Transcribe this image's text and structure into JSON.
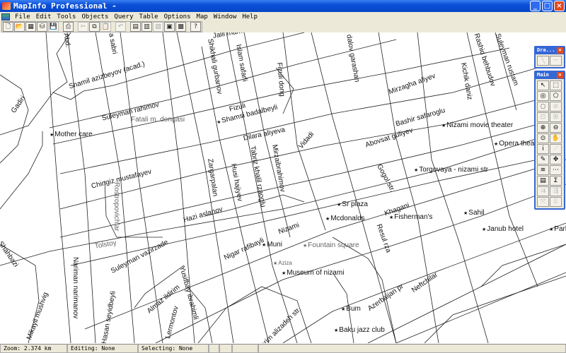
{
  "window": {
    "title": "MapInfo Professional -",
    "minimize": "_",
    "maximize": "□",
    "close": "×"
  },
  "menu": [
    "File",
    "Edit",
    "Tools",
    "Objects",
    "Query",
    "Table",
    "Options",
    "Map",
    "Window",
    "Help"
  ],
  "toolbar": {
    "new": "🗋",
    "open": "📂",
    "open_workspace": "▦",
    "open_dbms": "⛁",
    "save": "💾",
    "print": "⎙",
    "cut": "✂",
    "copy": "⧉",
    "paste": "📋",
    "undo": "↶",
    "new_browser": "▤",
    "new_mapper": "▥",
    "new_grapher": "▧",
    "new_layout": "▣",
    "new_redistrict": "▩",
    "help": "?"
  },
  "map": {
    "labels": [
      "Jalil mamm",
      "Shikhali gurbanov",
      "Islam safarli",
      "Fizuli dong",
      "dalov garashan",
      "Abd.",
      "a sabri",
      "Shamil azizbeyov (acad.)",
      "Suleyman rahimov",
      "Fatali m. dongasi",
      "Gadiri",
      "Mother care",
      "Fizuli",
      "Shamsi badalbeyli",
      "Dilara aliyeva",
      "Vidadi",
      "Mirzagha aliyev",
      "Bashir safaroglu",
      "Abovsat guliyev",
      "Nizami movie theater",
      "Opera theatre",
      "Rashid behbudov",
      "Kichik daniz",
      "Suleyman rustam",
      "Chingiz mustafayev",
      "Rostropovichlar",
      "Zargarpalan",
      "Husi hajiyev",
      "Tabriz khalil rzaoglu",
      "Mirzaibrahimov",
      "Hazi aslanov",
      "Nizami",
      "Gogol str.",
      "Torgovaya - nizami str",
      "Khagani",
      "Sr plaza",
      "Mcdonalds",
      "Fisherman's",
      "Resul rza",
      "Sahil",
      "Janub hotel",
      "Park",
      "Tolstoy",
      "Suleyman vazirzade",
      "Nigar rafibayli",
      "Muni",
      "Fountain square",
      "Aziza",
      "Museum of nizami",
      "Nariman narimanov",
      "Shahbazi",
      "Mikayil mushvig",
      "Almaz ildirim",
      "Yusifbay ibrahimli",
      "Lermontov",
      "Hasan seyidbeyli",
      "Abdulkarim alizadeh str.",
      "Azerbaijan pr",
      "Neftchilar",
      "Bum",
      "Baku jazz club"
    ]
  },
  "palettes": {
    "drawing": {
      "title": "Dra...",
      "close": "×",
      "tools": [
        "╲",
        "─"
      ]
    },
    "main": {
      "title": "Main",
      "close": "×",
      "tools": [
        "↖",
        "⬚",
        "◎",
        "⬠",
        "◌",
        "⊘",
        "⊡",
        "⊞",
        "⊕",
        "⊖",
        "⊙",
        "✋",
        "i",
        "⟋",
        "✎",
        "✥",
        "≋",
        "⋯",
        "▤",
        "Σ",
        "⇉",
        "⇶",
        "⤧",
        "⍂"
      ]
    }
  },
  "status": {
    "zoom": "Zoom: 2.374 km",
    "editing": "Editing: None",
    "selecting": "Selecting: None"
  }
}
